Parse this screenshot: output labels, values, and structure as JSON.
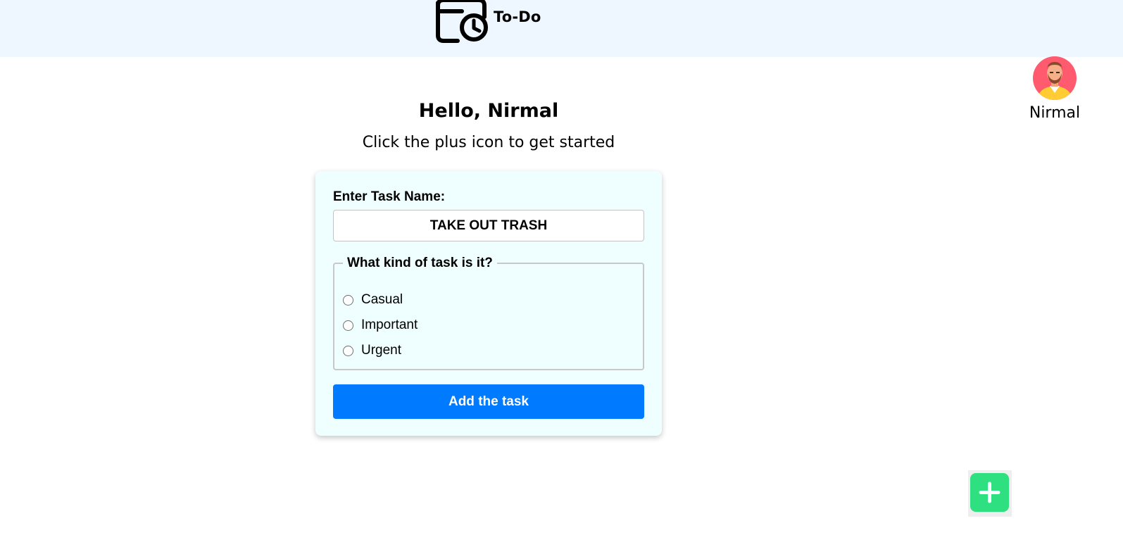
{
  "header": {
    "logo_icon": "calendar-clock-icon",
    "title": "To-Do"
  },
  "profile": {
    "avatar_icon": "user-avatar",
    "name": "Nirmal"
  },
  "main": {
    "greeting": "Hello, Nirmal",
    "subtitle": "Click the plus icon to get started"
  },
  "form": {
    "task_label": "Enter Task Name:",
    "task_value": "TAKE OUT TRASH",
    "kind_legend": "What kind of task is it?",
    "options": [
      {
        "label": "Casual",
        "selected": false
      },
      {
        "label": "Important",
        "selected": false
      },
      {
        "label": "Urgent",
        "selected": false
      }
    ],
    "submit_label": "Add the task"
  },
  "fab": {
    "icon": "plus-icon"
  },
  "colors": {
    "header_bg": "#eef6ff",
    "card_bg": "#effefe",
    "primary": "#007bff",
    "fab": "#2ee07f"
  }
}
